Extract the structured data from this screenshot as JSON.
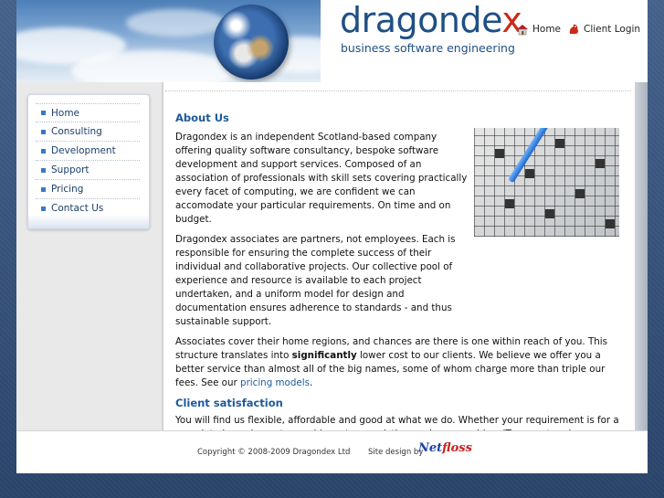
{
  "brand": {
    "name_main": "dragonde",
    "name_x": "x",
    "tagline": "business software engineering",
    "color_primary": "#1f4f86",
    "color_accent": "#cc2a1a"
  },
  "top_links": [
    {
      "label": "Home",
      "icon": "house-icon"
    },
    {
      "label": "Client Login",
      "icon": "dragon-icon"
    }
  ],
  "menu": {
    "items": [
      {
        "label": "Home"
      },
      {
        "label": "Consulting"
      },
      {
        "label": "Development"
      },
      {
        "label": "Support"
      },
      {
        "label": "Pricing"
      },
      {
        "label": "Contact Us"
      }
    ]
  },
  "content": {
    "about_heading": "About Us",
    "p1": "Dragondex is an independent Scotland-based company offering quality software consultancy, bespoke software development and support services. Composed of an association of professionals with skill sets covering practically every facet of computing, we are confident we can accomodate your particular requirements. On time and on budget.",
    "p2": "Dragondex associates are partners, not employees. Each is responsible for ensuring the complete success of their individual and collaborative projects. Our collective pool of experience and resource is available to each project undertaken, and a uniform model for design and documentation ensures adherence to standards - and thus sustainable support.",
    "p3_before": "Associates cover their home regions, and chances are there is one within reach of you. This structure translates into ",
    "p3_bold": "significantly",
    "p3_after": " lower cost to our clients. We believe we offer you a better service than almost all of the big names, some of whom charge more than triple our fees. See our ",
    "p3_link": "pricing models",
    "p3_end": ".",
    "client_heading": "Client satisfaction",
    "p4": "You will find us flexible, affordable and good at what we do. Whether your requirement is for a complete bespoke system, add-ons to an existing package or ad-hoc IT support and management services, get in touch and find out what we can do for you."
  },
  "footer": {
    "copyright": "Copyright © 2008-2009 Dragondex Ltd",
    "design_label": "Site design by",
    "design_logo_a": "Net",
    "design_logo_b": "floss"
  },
  "images": {
    "header": "globe-clouds-image",
    "content": "crossword-pen-image"
  }
}
